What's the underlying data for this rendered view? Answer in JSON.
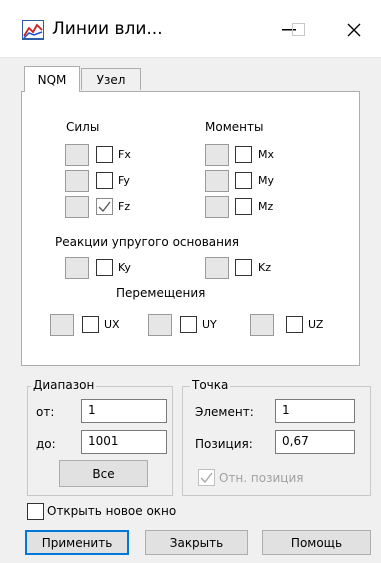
{
  "window": {
    "title": "Линии вли...",
    "minimize_glyph": "—",
    "maximize_glyph": "☐",
    "close_glyph": "✕",
    "app_icon": "chart-lines-icon"
  },
  "tabs": [
    {
      "label": "NQM",
      "active": true
    },
    {
      "label": "Узел",
      "active": false
    }
  ],
  "forces": {
    "heading": "Силы",
    "items": [
      {
        "label": "Fx",
        "checked": false
      },
      {
        "label": "Fy",
        "checked": false
      },
      {
        "label": "Fz",
        "checked": true
      }
    ]
  },
  "moments": {
    "heading": "Моменты",
    "items": [
      {
        "label": "Mx",
        "checked": false
      },
      {
        "label": "My",
        "checked": false
      },
      {
        "label": "Mz",
        "checked": false
      }
    ]
  },
  "reactions": {
    "heading": "Реакции упругого основания",
    "items": [
      {
        "label": "Ky",
        "checked": false
      },
      {
        "label": "Kz",
        "checked": false
      }
    ]
  },
  "displacements": {
    "heading": "Перемещения",
    "items": [
      {
        "label": "UX",
        "checked": false
      },
      {
        "label": "UY",
        "checked": false
      },
      {
        "label": "UZ",
        "checked": false
      }
    ]
  },
  "range": {
    "title": "Диапазон",
    "from_label": "от:",
    "from_value": "1",
    "to_label": "до:",
    "to_value": "1001",
    "all_button": "Все"
  },
  "point": {
    "title": "Точка",
    "element_label": "Элемент:",
    "element_value": "1",
    "position_label": "Позиция:",
    "position_value": "0,67",
    "relative_label": "Отн. позиция",
    "relative_checked": true,
    "relative_enabled": false
  },
  "open_new_window": {
    "label": "Открыть новое окно",
    "checked": false
  },
  "buttons": {
    "apply": "Применить",
    "close": "Закрыть",
    "help": "Помощь"
  },
  "colors": {
    "accent": "#0078d7",
    "check_mark": "#5a5a5a",
    "disabled_text": "#a0a0a0"
  }
}
